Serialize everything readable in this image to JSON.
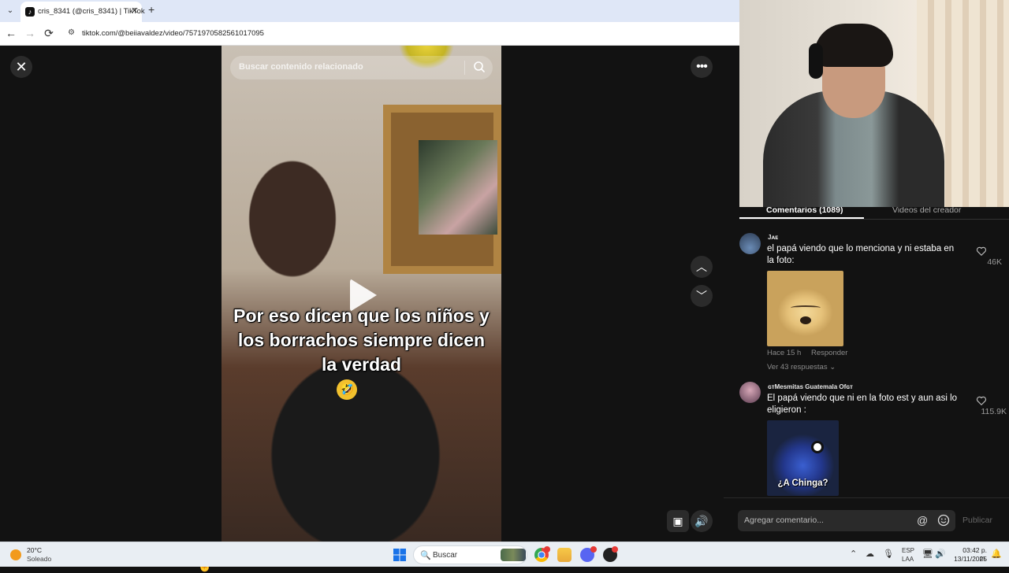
{
  "browser": {
    "tab_title": "cris_8341 (@cris_8341) | TikTok",
    "url": "tiktok.com/@beiiavaldez/video/7571970582561017095",
    "back_icon": "←",
    "forward_icon": "→",
    "reload_icon": "⟳",
    "new_tab_icon": "+",
    "tab_close_icon": "✕"
  },
  "video": {
    "search_placeholder": "Buscar contenido relacionado",
    "caption": "Por eso dicen que los niños y los borrachos siempre dicen la verdad",
    "caption_emoji": "🤣",
    "close_icon": "✕",
    "more_icon": "•••",
    "up_icon": "︿",
    "down_icon": "﹀",
    "volume_icon": "🔊",
    "miniplayer_icon": "▣"
  },
  "comments_panel": {
    "tab_comments": "Comentarios (1089)",
    "tab_creator_videos": "Videos del creador",
    "comments": [
      {
        "user": "Jᴀᴇ",
        "text": "el papá viendo que lo menciona y ni estaba en la foto:",
        "time": "Hace 15 h",
        "reply_label": "Responder",
        "replies_label": "Ver 43 respuestas ⌄",
        "likes": "46K"
      },
      {
        "user": "ɢᴛMesmitas Guatemala Ofɢᴛ",
        "text": "El papá viendo que ni en la foto est y aun asi lo eligieron :",
        "image_caption": "¿A Chinga?",
        "likes": "115.9K"
      }
    ],
    "input_placeholder": "Agregar comentario...",
    "at_icon": "@",
    "post_label": "Publicar"
  },
  "taskbar": {
    "weather_temp": "20°C",
    "weather_desc": "Soleado",
    "search_label": "Buscar",
    "search_icon": "🔍",
    "lang_line1": "ESP",
    "lang_line2": "LAA",
    "clock_time": "03:42 p. m.",
    "clock_date": "13/11/2025",
    "tray_chevron": "⌃",
    "tray_cloud": "☁",
    "tray_mic": "🎙",
    "tray_net": "🖥",
    "tray_vol": "🔊",
    "tray_notif": "🔔"
  }
}
